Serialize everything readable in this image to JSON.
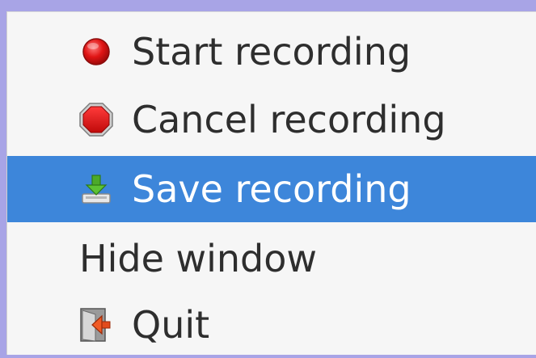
{
  "menu": {
    "items": [
      {
        "label": "Start recording",
        "icon": "record-icon",
        "selected": false
      },
      {
        "label": "Cancel recording",
        "icon": "stop-icon",
        "selected": false
      },
      {
        "label": "Save recording",
        "icon": "save-download-icon",
        "selected": true
      },
      {
        "label": "Hide window",
        "icon": "",
        "selected": false
      },
      {
        "label": "Quit",
        "icon": "exit-door-icon",
        "selected": false
      }
    ]
  },
  "colors": {
    "background": "#a8a4e6",
    "menu_bg": "#f6f6f6",
    "selection": "#3d86da",
    "text": "#2e2e2e",
    "selected_text": "#ffffff"
  }
}
